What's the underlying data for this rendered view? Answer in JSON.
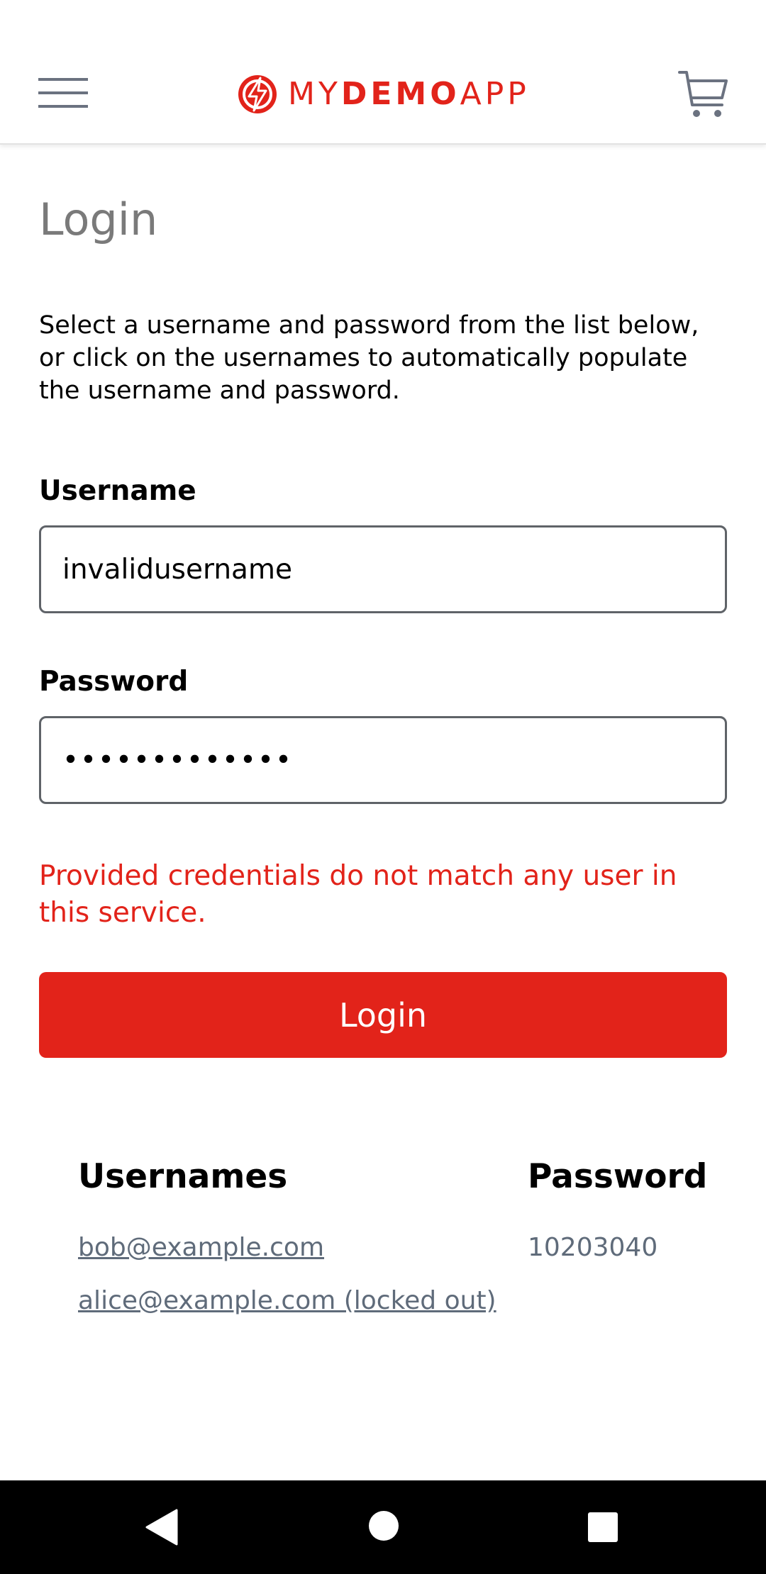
{
  "header": {
    "logo": {
      "part1": "MY",
      "part2": "DEMO",
      "part3": "APP"
    },
    "icons": {
      "menu": "hamburger-menu-icon",
      "cart": "cart-icon",
      "logo": "lightning-bolt-icon"
    },
    "colors": {
      "brand": "#e2231a"
    }
  },
  "login": {
    "title": "Login",
    "instructions": "Select a username and password from the list below, or click on the usernames to automatically populate the username and password.",
    "username_label": "Username",
    "username_value": "invalidusername",
    "password_label": "Password",
    "password_value": "•••••••••••••",
    "error": "Provided credentials do not match any user in this service.",
    "button_label": "Login"
  },
  "credentials": {
    "usernames_header": "Usernames",
    "password_header": "Password",
    "users": [
      "bob@example.com",
      "alice@example.com (locked out)"
    ],
    "password": "10203040"
  },
  "navbar": {
    "icons": [
      "back-triangle-icon",
      "home-circle-icon",
      "recents-square-icon"
    ]
  }
}
